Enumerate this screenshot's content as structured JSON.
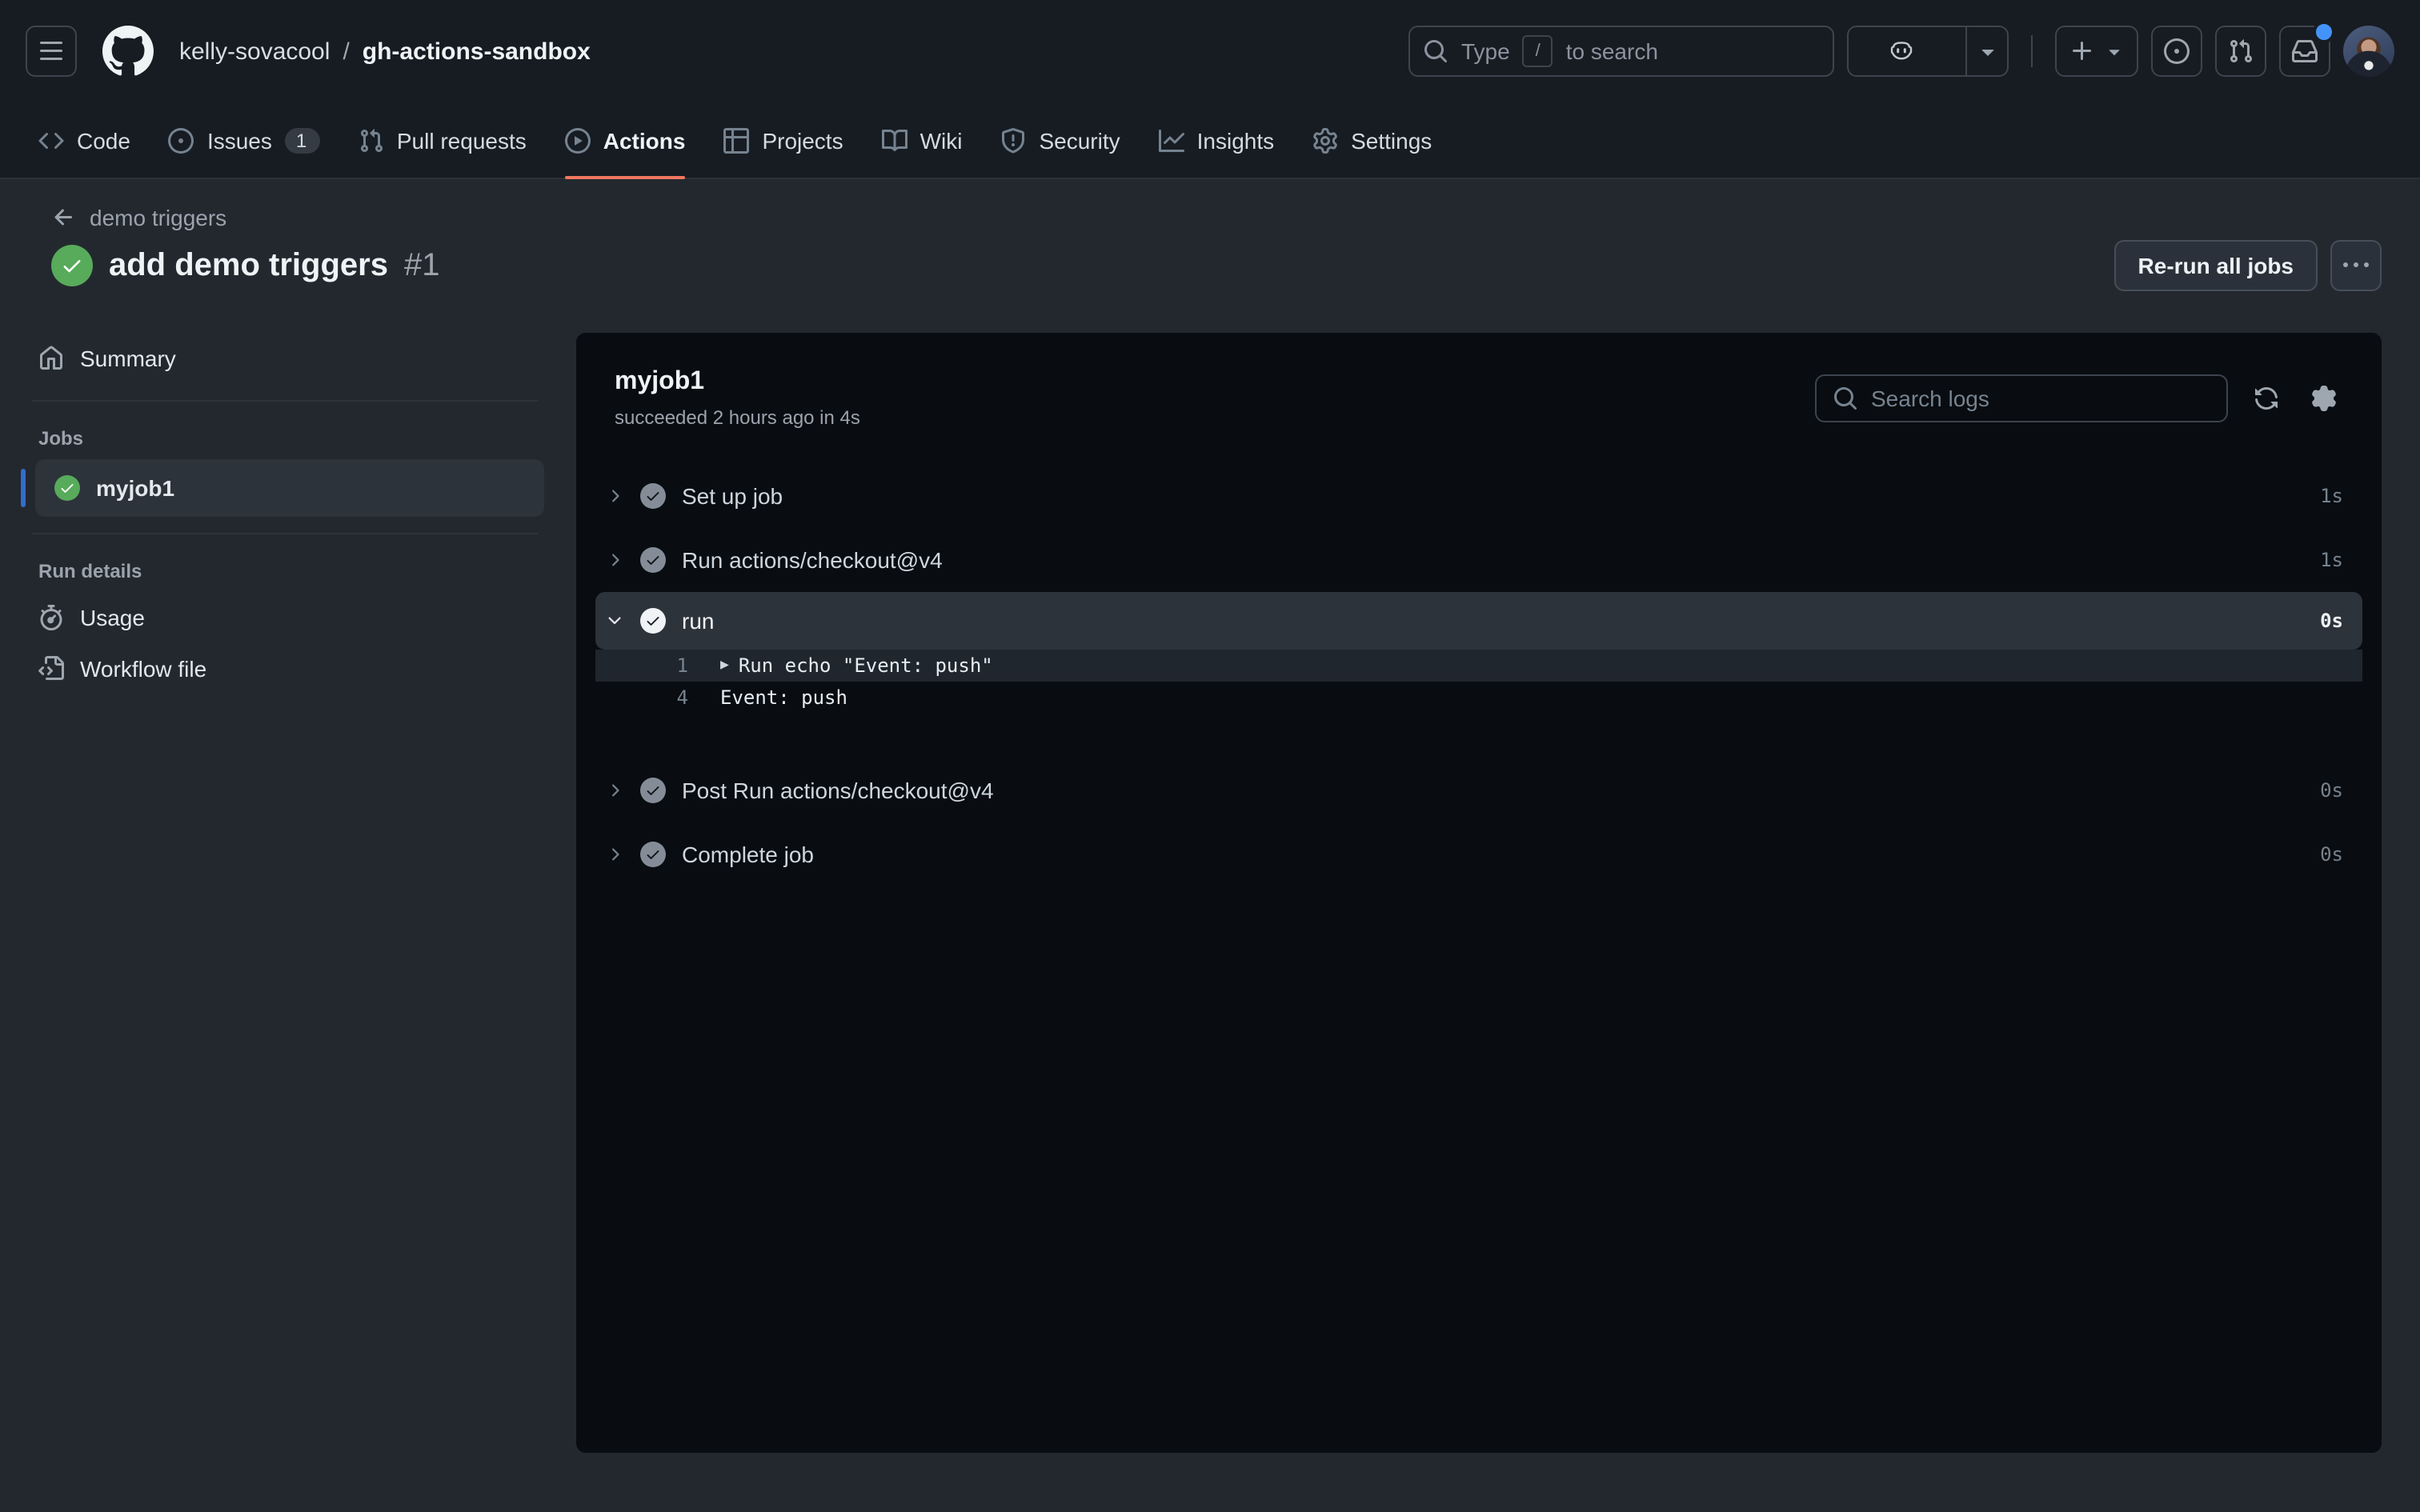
{
  "header": {
    "breadcrumb": {
      "owner": "kelly-sovacool",
      "separator": "/",
      "repo": "gh-actions-sandbox"
    },
    "search": {
      "prefix": "Type",
      "key": "/",
      "suffix": "to search"
    }
  },
  "nav": {
    "tabs": [
      {
        "label": "Code"
      },
      {
        "label": "Issues",
        "badge": "1"
      },
      {
        "label": "Pull requests"
      },
      {
        "label": "Actions",
        "active": true
      },
      {
        "label": "Projects"
      },
      {
        "label": "Wiki"
      },
      {
        "label": "Security"
      },
      {
        "label": "Insights"
      },
      {
        "label": "Settings"
      }
    ]
  },
  "run_header": {
    "back_label": "demo triggers",
    "title": "add demo triggers",
    "number": "#1",
    "rerun_label": "Re-run all jobs"
  },
  "sidebar": {
    "summary_label": "Summary",
    "jobs_heading": "Jobs",
    "jobs": [
      {
        "name": "myjob1",
        "status": "success",
        "selected": true
      }
    ],
    "run_details_heading": "Run details",
    "usage_label": "Usage",
    "workflow_label": "Workflow file"
  },
  "panel": {
    "job_name": "myjob1",
    "status_line": "succeeded 2 hours ago in 4s",
    "search_placeholder": "Search logs",
    "steps": [
      {
        "label": "Set up job",
        "duration": "1s",
        "status": "success"
      },
      {
        "label": "Run actions/checkout@v4",
        "duration": "1s",
        "status": "success"
      },
      {
        "label": "run",
        "duration": "0s",
        "status": "success",
        "expanded": true
      },
      {
        "label": "Post Run actions/checkout@v4",
        "duration": "0s",
        "status": "success"
      },
      {
        "label": "Complete job",
        "duration": "0s",
        "status": "success"
      }
    ],
    "log_lines": [
      {
        "num": "1",
        "toggle": "▶",
        "text": "Run echo \"Event: push\"",
        "highlighted": true
      },
      {
        "num": "4",
        "text": "Event: push",
        "highlighted": false
      }
    ]
  },
  "colors": {
    "tab_underline": "#f0765f",
    "success_green": "#57ab5a",
    "job_accent_blue": "#316dca",
    "notification_blue": "#4493f8",
    "panel_background": "#090c10",
    "page_background": "#23282f"
  }
}
